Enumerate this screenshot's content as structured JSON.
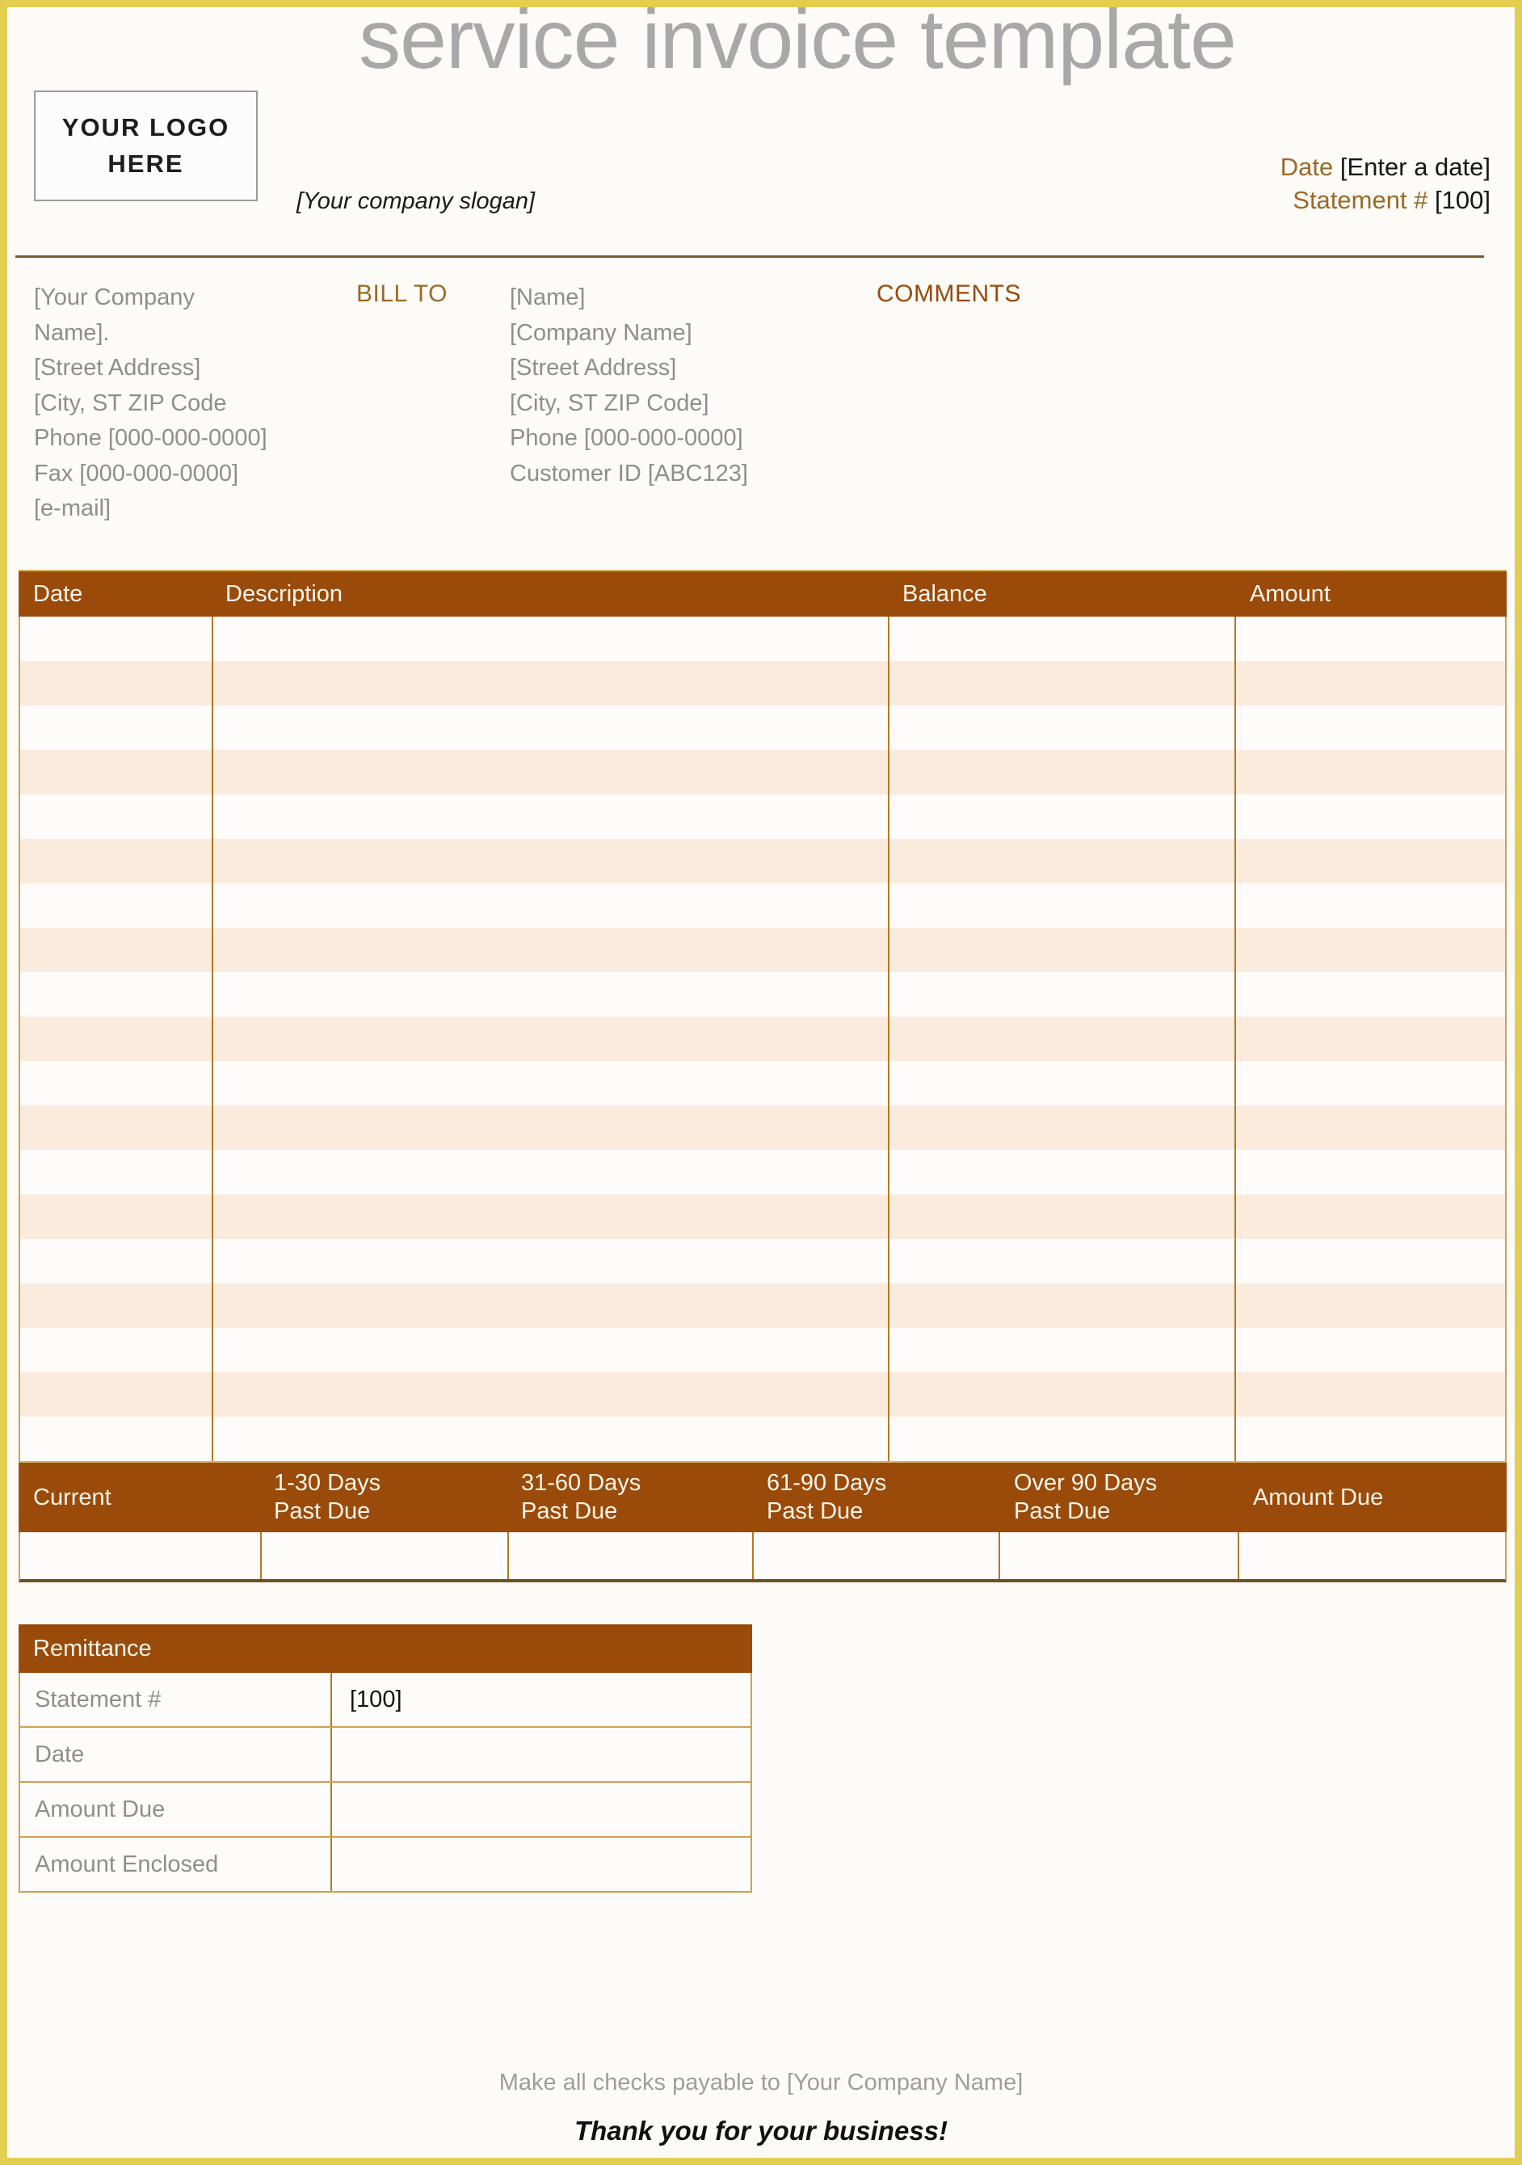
{
  "document": {
    "title": "service invoice template"
  },
  "logo": {
    "line1": "YOUR LOGO",
    "line2": "HERE"
  },
  "slogan": "[Your company slogan]",
  "meta": {
    "date_label": "Date",
    "date_value": "[Enter a date]",
    "statement_label": "Statement #",
    "statement_value": "[100]"
  },
  "from_address": {
    "lines": [
      "[Your Company",
      "Name].",
      "[Street Address]",
      "[City, ST  ZIP Code",
      "Phone [000-000-0000]",
      "Fax [000-000-0000]",
      "[e-mail]"
    ]
  },
  "bill_to_label": "BILL TO",
  "bill_to_address": {
    "lines": [
      "[Name]",
      "[Company Name]",
      "[Street Address]",
      "[City, ST  ZIP Code]",
      "Phone [000-000-0000]",
      "Customer ID [ABC123]"
    ]
  },
  "comments_label": "COMMENTS",
  "line_items_table": {
    "columns": [
      "Date",
      "Description",
      "Balance",
      "Amount"
    ],
    "row_count": 19,
    "rows": []
  },
  "aging_summary": {
    "columns": [
      "Current",
      "1-30 Days\nPast Due",
      "31-60 Days\nPast Due",
      "61-90 Days\nPast Due",
      "Over 90 Days\nPast Due",
      "Amount Due"
    ],
    "col_current": "Current",
    "col_1_30_l1": "1-30 Days",
    "col_1_30_l2": "Past Due",
    "col_31_60_l1": "31-60 Days",
    "col_31_60_l2": "Past Due",
    "col_61_90_l1": "61-90 Days",
    "col_61_90_l2": "Past Due",
    "col_over90_l1": "Over 90 Days",
    "col_over90_l2": "Past Due",
    "col_amount_due": "Amount Due",
    "values": [
      "",
      "",
      "",
      "",
      "",
      ""
    ]
  },
  "remittance": {
    "title": "Remittance",
    "rows": [
      {
        "label": "Statement #",
        "value": "[100]"
      },
      {
        "label": "Date",
        "value": ""
      },
      {
        "label": "Amount Due",
        "value": ""
      },
      {
        "label": "Amount Enclosed",
        "value": ""
      }
    ]
  },
  "footer": {
    "payable_to": "Make all checks payable to [Your Company Name]",
    "thanks": "Thank you for your business!"
  },
  "colors": {
    "page_border": "#e3ce4f",
    "header_brown": "#9a4a09",
    "accent_gold": "#9a6a26",
    "row_stripe": "#fbebdd",
    "grid_line": "#b07a27",
    "title_gray": "#a8a8a8",
    "body_gray": "#8e8e8e"
  }
}
